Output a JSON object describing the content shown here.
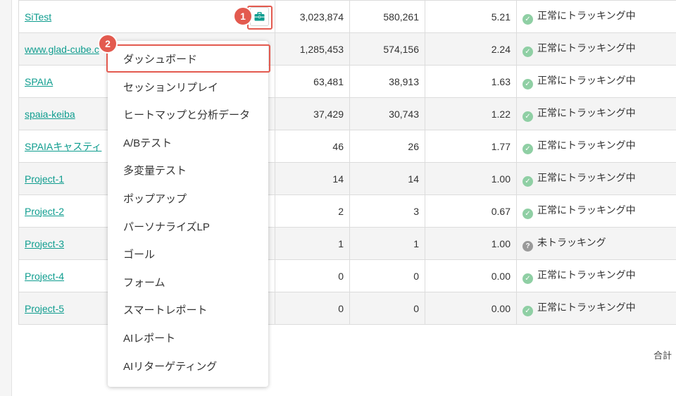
{
  "sites": [
    {
      "name": "SiTest",
      "v1": "3,023,874",
      "v2": "580,261",
      "v3": "5.21",
      "status": "正常にトラッキング中",
      "status_type": "ok"
    },
    {
      "name": "www.glad-cube.c",
      "v1": "1,285,453",
      "v2": "574,156",
      "v3": "2.24",
      "status": "正常にトラッキング中",
      "status_type": "ok"
    },
    {
      "name": "SPAIA",
      "v1": "63,481",
      "v2": "38,913",
      "v3": "1.63",
      "status": "正常にトラッキング中",
      "status_type": "ok"
    },
    {
      "name": "spaia-keiba",
      "v1": "37,429",
      "v2": "30,743",
      "v3": "1.22",
      "status": "正常にトラッキング中",
      "status_type": "ok"
    },
    {
      "name": "SPAIAキャスティ",
      "v1": "46",
      "v2": "26",
      "v3": "1.77",
      "status": "正常にトラッキング中",
      "status_type": "ok"
    },
    {
      "name": "Project-1",
      "v1": "14",
      "v2": "14",
      "v3": "1.00",
      "status": "正常にトラッキング中",
      "status_type": "ok"
    },
    {
      "name": "Project-2",
      "v1": "2",
      "v2": "3",
      "v3": "0.67",
      "status": "正常にトラッキング中",
      "status_type": "ok"
    },
    {
      "name": "Project-3",
      "v1": "1",
      "v2": "1",
      "v3": "1.00",
      "status": "未トラッキング",
      "status_type": "unknown"
    },
    {
      "name": "Project-4",
      "v1": "0",
      "v2": "0",
      "v3": "0.00",
      "status": "正常にトラッキング中",
      "status_type": "ok"
    },
    {
      "name": "Project-5",
      "v1": "0",
      "v2": "0",
      "v3": "0.00",
      "status": "正常にトラッキング中",
      "status_type": "ok"
    }
  ],
  "total_label": "合計",
  "menu": {
    "items": [
      "ダッシュボード",
      "セッションリプレイ",
      "ヒートマップと分析データ",
      "A/Bテスト",
      "多変量テスト",
      "ポップアップ",
      "パーソナライズLP",
      "ゴール",
      "フォーム",
      "スマートレポート",
      "AIレポート",
      "AIリターゲティング"
    ]
  },
  "annotations": {
    "step1": "1",
    "step2": "2"
  },
  "colors": {
    "accent": "#0f9d8f",
    "callout": "#e35a4f",
    "status_ok": "#8fcfa4"
  },
  "icons": {
    "tool": "briefcase-icon",
    "ok": "check-circle-icon",
    "unknown": "question-circle-icon"
  }
}
